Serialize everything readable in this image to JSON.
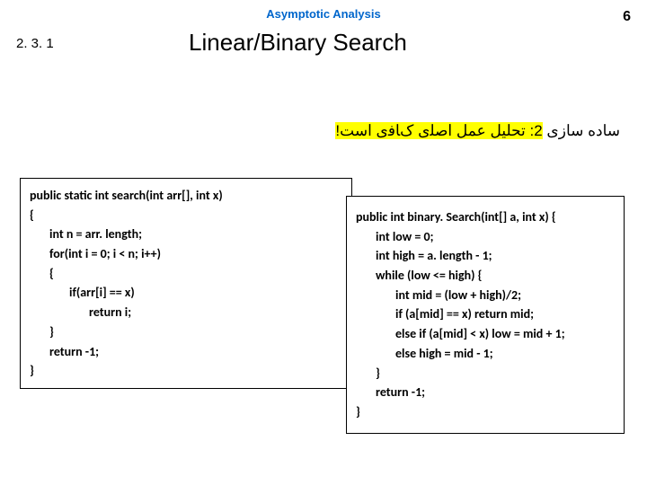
{
  "header": {
    "topic": "Asymptotic Analysis",
    "page_number": "6",
    "section": "2. 3. 1",
    "title": "Linear/Binary Search"
  },
  "persian": {
    "prefix": "ﺳﺎﺩﻩ ﺳﺎﺯی ",
    "highlight": "2: ﺗﺤﻠﻴﻞ ﻋﻤﻞ ﺍﺻﻠی کﺎﻓی ﺍﺳﺖ!"
  },
  "code_left": {
    "l1": "public static int search(int arr[], int x)",
    "l2": "{",
    "l3": "int n = arr. length;",
    "l4": "for(int i = 0; i < n; i++)",
    "l5": "{",
    "l6": "if(arr[i] == x)",
    "l7": "return i;",
    "l8": "}",
    "l9": "return -1;",
    "l10": "}"
  },
  "code_right": {
    "l1": "public int binary. Search(int[] a, int x) {",
    "l2": "int low = 0;",
    "l3": "int high = a. length - 1;",
    "l4": "while (low <= high) {",
    "l5": "int mid = (low + high)/2;",
    "l6": "if (a[mid] == x) return mid;",
    "l7": "else if (a[mid] < x) low = mid + 1;",
    "l8": "else high = mid - 1;",
    "l9": "}",
    "l10": "return -1;",
    "l11": "}"
  }
}
